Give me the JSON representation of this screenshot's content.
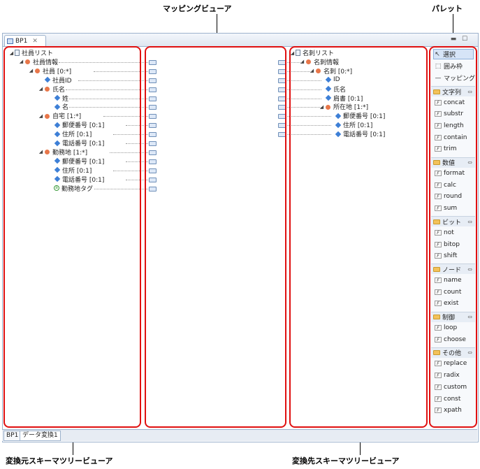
{
  "callouts": {
    "mapping_viewer": "マッピングビューア",
    "palette": "パレット",
    "source_viewer": "変換元スキーマツリービューア",
    "target_viewer": "変換先スキーマツリービューア"
  },
  "editor": {
    "tab_label": "BP1"
  },
  "source_tree": [
    {
      "label": "社員リスト",
      "depth": 0,
      "icon": "doc"
    },
    {
      "label": "社員情報",
      "depth": 1,
      "icon": "element"
    },
    {
      "label": "社員 [0:*]",
      "depth": 2,
      "icon": "element"
    },
    {
      "label": "社員ID",
      "depth": 3,
      "icon": "attribute"
    },
    {
      "label": "氏名",
      "depth": 3,
      "icon": "element"
    },
    {
      "label": "姓",
      "depth": 4,
      "icon": "attribute"
    },
    {
      "label": "名",
      "depth": 4,
      "icon": "attribute"
    },
    {
      "label": "自宅 [1:*]",
      "depth": 3,
      "icon": "element"
    },
    {
      "label": "郵便番号 [0:1]",
      "depth": 4,
      "icon": "attribute"
    },
    {
      "label": "住所 [0:1]",
      "depth": 4,
      "icon": "attribute"
    },
    {
      "label": "電話番号 [0:1]",
      "depth": 4,
      "icon": "attribute"
    },
    {
      "label": "勤務地 [1:*]",
      "depth": 3,
      "icon": "element"
    },
    {
      "label": "郵便番号 [0:1]",
      "depth": 4,
      "icon": "attribute"
    },
    {
      "label": "住所 [0:1]",
      "depth": 4,
      "icon": "attribute"
    },
    {
      "label": "電話番号 [0:1]",
      "depth": 4,
      "icon": "attribute"
    },
    {
      "label": "勤務地タグ",
      "depth": 4,
      "icon": "tag"
    }
  ],
  "target_tree": [
    {
      "label": "名刺リスト",
      "depth": 0,
      "icon": "doc"
    },
    {
      "label": "名刺情報",
      "depth": 1,
      "icon": "element"
    },
    {
      "label": "名刺 [0:*]",
      "depth": 2,
      "icon": "element"
    },
    {
      "label": "ID",
      "depth": 3,
      "icon": "attribute"
    },
    {
      "label": "氏名",
      "depth": 3,
      "icon": "attribute"
    },
    {
      "label": "肩書 [0:1]",
      "depth": 3,
      "icon": "attribute"
    },
    {
      "label": "所在地 [1:*]",
      "depth": 3,
      "icon": "element"
    },
    {
      "label": "郵便番号 [0:1]",
      "depth": 4,
      "icon": "attribute"
    },
    {
      "label": "住所 [0:1]",
      "depth": 4,
      "icon": "attribute"
    },
    {
      "label": "電話番号 [0:1]",
      "depth": 4,
      "icon": "attribute"
    }
  ],
  "palette": {
    "tools": [
      {
        "label": "選択",
        "icon": "select-cursor-icon"
      },
      {
        "label": "囲み枠",
        "icon": "marquee-icon"
      },
      {
        "label": "マッピング",
        "icon": "mapping-line-icon"
      }
    ],
    "groups": [
      {
        "name": "文字列",
        "items": [
          "concat",
          "substr",
          "length",
          "contain",
          "trim"
        ]
      },
      {
        "name": "数値",
        "items": [
          "format",
          "calc",
          "round",
          "sum"
        ]
      },
      {
        "name": "ビット",
        "items": [
          "not",
          "bitop",
          "shift"
        ]
      },
      {
        "name": "ノード",
        "items": [
          "name",
          "count",
          "exist"
        ]
      },
      {
        "name": "制御",
        "items": [
          "loop",
          "choose"
        ]
      },
      {
        "name": "その他",
        "items": [
          "replace",
          "radix",
          "custom",
          "const",
          "xpath"
        ]
      }
    ]
  },
  "bottom_tabs": [
    "BP1",
    "データ変換1"
  ]
}
